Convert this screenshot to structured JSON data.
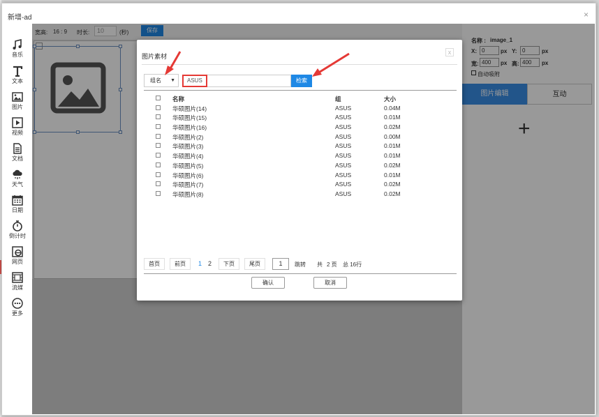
{
  "window": {
    "title": "新增-ad",
    "close": "×"
  },
  "toolbar": [
    {
      "label": "音乐",
      "icon": "music-icon"
    },
    {
      "label": "文本",
      "icon": "text-icon"
    },
    {
      "label": "图片",
      "icon": "image-icon"
    },
    {
      "label": "视频",
      "icon": "video-icon"
    },
    {
      "label": "文档",
      "icon": "document-icon"
    },
    {
      "label": "天气",
      "icon": "weather-icon"
    },
    {
      "label": "日期",
      "icon": "calendar-icon"
    },
    {
      "label": "倒计时",
      "icon": "stopwatch-icon"
    },
    {
      "label": "网页",
      "icon": "web-icon"
    },
    {
      "label": "流媒",
      "icon": "stream-icon"
    },
    {
      "label": "更多",
      "icon": "more-icon"
    }
  ],
  "editor": {
    "ratio_label": "宽高:",
    "ratio_value": "16 : 9",
    "duration_label": "时长:",
    "duration_value": "10",
    "duration_unit": "(秒)",
    "save_label": "保存"
  },
  "props": {
    "name_label": "名称 :",
    "name_value": "image_1",
    "x_label": "X:",
    "x_value": "0",
    "y_label": "Y:",
    "y_value": "0",
    "w_label": "宽:",
    "w_value": "400",
    "h_label": "高:",
    "h_value": "400",
    "unit": "px",
    "snap_label": "自动吸附",
    "tab_active": "图片编辑",
    "tab_other": "互动",
    "add": "+"
  },
  "modal": {
    "title": "图片素材",
    "close": "x",
    "select_value": "组名",
    "search_value": "ASUS",
    "search_button": "检索",
    "headers": {
      "name": "名称",
      "group": "组",
      "size": "大小"
    },
    "rows": [
      {
        "name": "华硕图片(14)",
        "group": "ASUS",
        "size": "0.04M"
      },
      {
        "name": "华硕图片(15)",
        "group": "ASUS",
        "size": "0.01M"
      },
      {
        "name": "华硕图片(16)",
        "group": "ASUS",
        "size": "0.02M"
      },
      {
        "name": "华硕图片(2)",
        "group": "ASUS",
        "size": "0.00M"
      },
      {
        "name": "华硕图片(3)",
        "group": "ASUS",
        "size": "0.01M"
      },
      {
        "name": "华硕图片(4)",
        "group": "ASUS",
        "size": "0.01M"
      },
      {
        "name": "华硕图片(5)",
        "group": "ASUS",
        "size": "0.02M"
      },
      {
        "name": "华硕图片(6)",
        "group": "ASUS",
        "size": "0.01M"
      },
      {
        "name": "华硕图片(7)",
        "group": "ASUS",
        "size": "0.02M"
      },
      {
        "name": "华硕图片(8)",
        "group": "ASUS",
        "size": "0.02M"
      }
    ],
    "pager": {
      "first": "首页",
      "prev": "前页",
      "page1": "1",
      "page2": "2",
      "next": "下页",
      "last": "尾页",
      "jump_value": "1",
      "jump": "跳转",
      "total_prefix": "共",
      "total_pages": "2 页",
      "total_rows": "总 16行"
    },
    "confirm": "确认",
    "cancel": "取消"
  },
  "colors": {
    "accent": "#1e88e5",
    "highlight": "#e53935"
  }
}
